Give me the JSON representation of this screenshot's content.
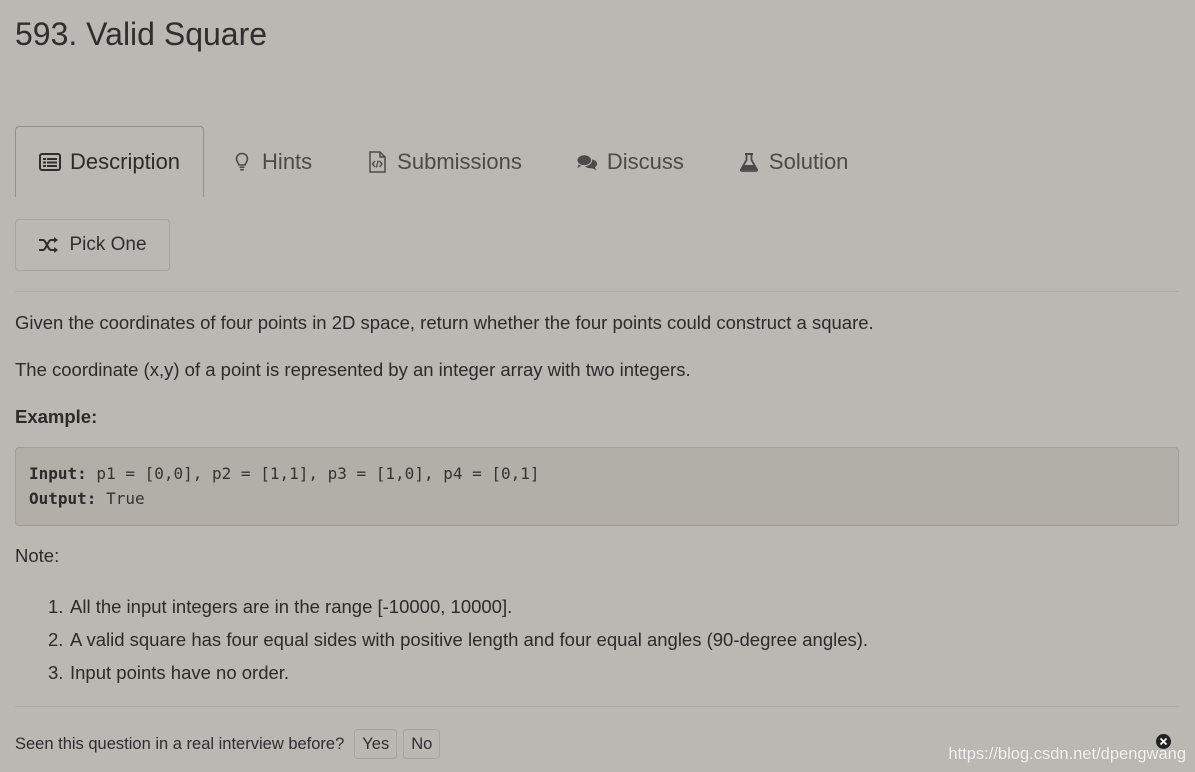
{
  "problem": {
    "title": "593. Valid Square"
  },
  "tabs": [
    {
      "label": "Description",
      "icon": "list-icon",
      "active": true
    },
    {
      "label": "Hints",
      "icon": "lightbulb-icon",
      "active": false
    },
    {
      "label": "Submissions",
      "icon": "code-file-icon",
      "active": false
    },
    {
      "label": "Discuss",
      "icon": "comments-icon",
      "active": false
    },
    {
      "label": "Solution",
      "icon": "flask-icon",
      "active": false
    }
  ],
  "pick_one": {
    "label": "Pick One",
    "icon": "shuffle-icon"
  },
  "description": {
    "para1": "Given the coordinates of four points in 2D space, return whether the four points could construct a square.",
    "para2": "The coordinate (x,y) of a point is represented by an integer array with two integers.",
    "example_heading": "Example:",
    "example": {
      "input_key": "Input:",
      "input_value": " p1 = [0,0], p2 = [1,1], p3 = [1,0], p4 = [0,1]",
      "output_key": "Output:",
      "output_value": " True"
    },
    "note_heading": "Note:",
    "notes": [
      {
        "num": "1.",
        "text": "All the input integers are in the range [-10000, 10000]."
      },
      {
        "num": "2.",
        "text": "A valid square has four equal sides with positive length and four equal angles (90-degree angles)."
      },
      {
        "num": "3.",
        "text": "Input points have no order."
      }
    ]
  },
  "interview": {
    "question": "Seen this question in a real interview before?",
    "yes": "Yes",
    "no": "No"
  },
  "watermark": "https://blog.csdn.net/dpengwang",
  "colors": {
    "background": "#b9b8b3",
    "code_background": "#b2afa8",
    "text": "#2b2b2b"
  }
}
